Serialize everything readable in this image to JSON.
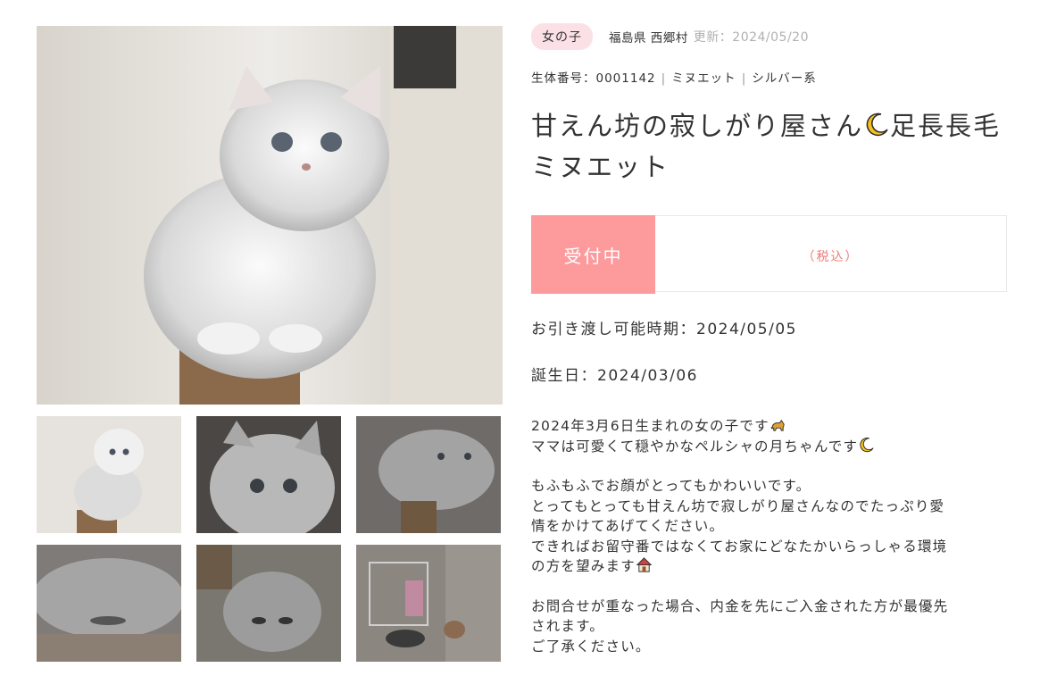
{
  "listing": {
    "gender_badge": "女の子",
    "location": "福島県 西郷村",
    "updated": "更新：2024/05/20",
    "id_label": "生体番号：0001142",
    "breed": "ミヌエット",
    "color": "シルバー系",
    "title_part1": "甘えん坊の寂しがり屋さん",
    "title_part2": "足長長毛ミヌエット",
    "status": "受付中",
    "tax_note": "（税込）",
    "delivery": "お引き渡し可能時期：2024/05/05",
    "birthday": "誕生日：2024/03/06"
  },
  "description": {
    "p1_l1": "2024年3月6日生まれの女の子です",
    "p1_l2": "ママは可愛くて穏やかなペルシャの月ちゃんです",
    "p2_l1": "もふもふでお顔がとってもかわいいです。",
    "p2_l2": "とってもとっても甘えん坊で寂しがり屋さんなのでたっぷり愛",
    "p2_l3": "情をかけてあげてください。",
    "p2_l4": "できればお留守番ではなくてお家にどなたかいらっしゃる環境",
    "p2_l5": "の方を望みます",
    "p3_l1": "お問合せが重なった場合、内金を先にご入金された方が最優先",
    "p3_l2": "されます。",
    "p3_l3": "ご了承ください。"
  },
  "icons": {
    "moon": "crescent-moon-icon",
    "cat": "cat-icon",
    "house": "house-icon"
  },
  "colors": {
    "status_bg": "#fc9a9c",
    "badge_bg": "#fbe1e5",
    "tax_text": "#f07a7a"
  }
}
